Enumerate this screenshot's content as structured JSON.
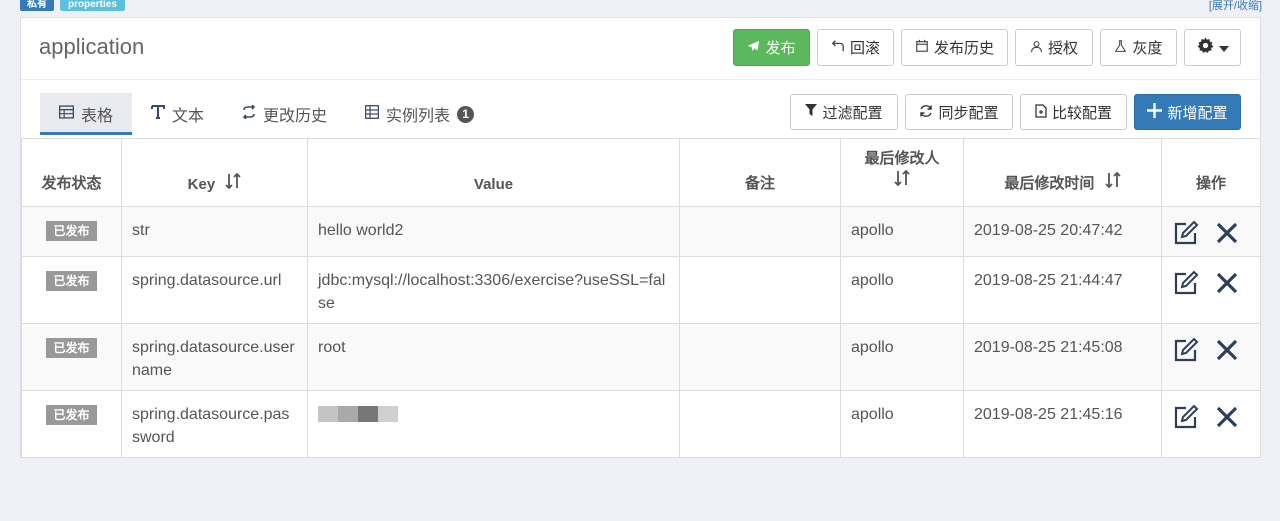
{
  "top": {
    "badge_private": "私有",
    "badge_format": "properties",
    "expand_link": "[展开/收缩]"
  },
  "namespace": {
    "title": "application"
  },
  "header_buttons": {
    "publish": "发布",
    "rollback": "回滚",
    "history": "发布历史",
    "authorize": "授权",
    "gray": "灰度"
  },
  "tabs": [
    {
      "label": "表格",
      "icon": "table-icon"
    },
    {
      "label": "文本",
      "icon": "text-icon"
    },
    {
      "label": "更改历史",
      "icon": "history-icon"
    },
    {
      "label": "实例列表",
      "icon": "instance-list-icon",
      "badge": "1"
    }
  ],
  "tools": {
    "filter": "过滤配置",
    "sync": "同步配置",
    "compare": "比较配置",
    "add": "新增配置"
  },
  "columns": {
    "status": "发布状态",
    "key": "Key",
    "value": "Value",
    "comment": "备注",
    "modifier": "最后修改人",
    "modified_time": "最后修改时间",
    "ops": "操作"
  },
  "rows": [
    {
      "status": "已发布",
      "key": "str",
      "value": "hello world2",
      "comment": "",
      "modifier": "apollo",
      "time": "2019-08-25 20:47:42"
    },
    {
      "status": "已发布",
      "key": "spring.datasource.url",
      "value": "jdbc:mysql://localhost:3306/exercise?useSSL=false",
      "comment": "",
      "modifier": "apollo",
      "time": "2019-08-25 21:44:47"
    },
    {
      "status": "已发布",
      "key": "spring.datasource.username",
      "value": "root",
      "comment": "",
      "modifier": "apollo",
      "time": "2019-08-25 21:45:08"
    },
    {
      "status": "已发布",
      "key": "spring.datasource.password",
      "value": "",
      "comment": "",
      "modifier": "apollo",
      "time": "2019-08-25 21:45:16"
    }
  ],
  "colors": {
    "primary": "#337ab7",
    "success": "#5cb85c",
    "info": "#5bc0de",
    "published_badge": "#999999"
  }
}
